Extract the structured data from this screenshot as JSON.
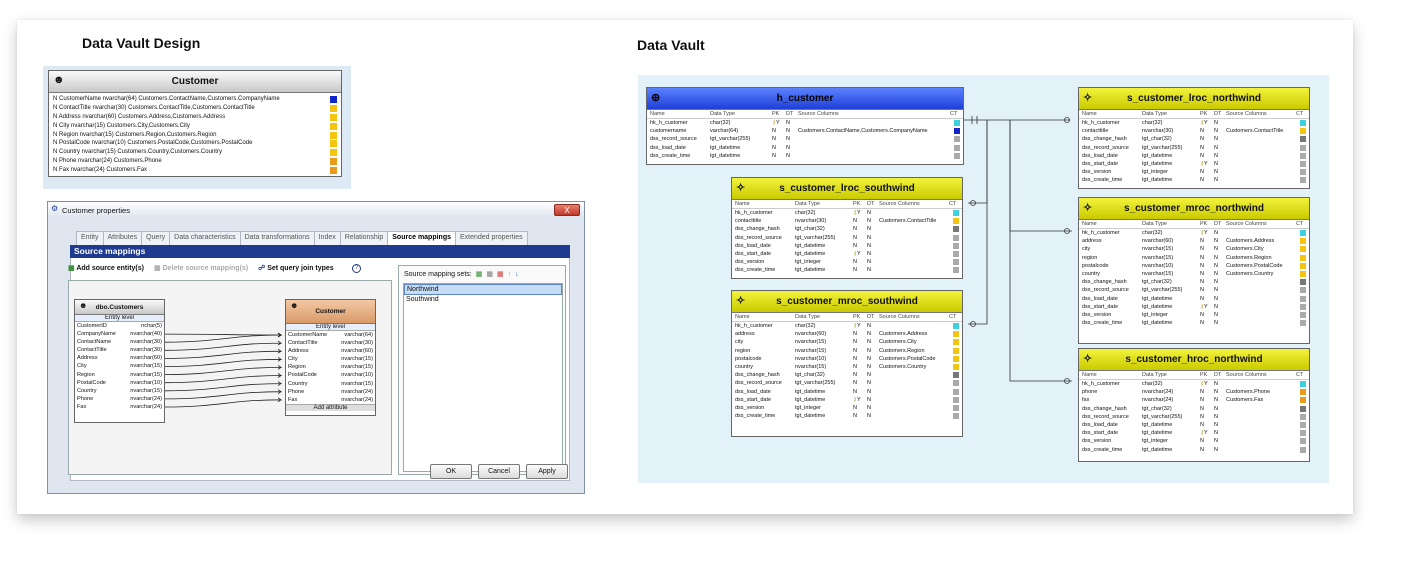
{
  "headings": {
    "left": "Data Vault Design",
    "right": "Data Vault"
  },
  "design_table": {
    "title": "Customer",
    "rows": [
      {
        "text": "N  CustomerName   nvarchar(64)   Customers.ContactName,Customers.CompanyName",
        "color": "#1226c9"
      },
      {
        "text": "N  ContactTitle      nvarchar(30)   Customers.ContactTitle,Customers.ContactTitle",
        "color": "#f4c410"
      },
      {
        "text": "N  Address           nvarchar(60)   Customers.Address,Customers.Address",
        "color": "#f4c410"
      },
      {
        "text": "N  City                 nvarchar(15)   Customers.City,Customers.City",
        "color": "#f4c410"
      },
      {
        "text": "N  Region            nvarchar(15)   Customers.Region,Customers.Region",
        "color": "#f4c410"
      },
      {
        "text": "N  PostalCode       nvarchar(10)   Customers.PostalCode,Customers.PostalCode",
        "color": "#f4c410"
      },
      {
        "text": "N  Country            nvarchar(15)   Customers.Country,Customers.Country",
        "color": "#f4c410"
      },
      {
        "text": "N  Phone              nvarchar(24)   Customers.Phone",
        "color": "#e89a1a"
      },
      {
        "text": "N  Fax                  nvarchar(24)   Customers.Fax",
        "color": "#e89a1a"
      }
    ]
  },
  "dialog": {
    "title": "Customer properties",
    "close": "X",
    "tabs": [
      "Entity",
      "Attributes",
      "Query",
      "Data characteristics",
      "Data transformations",
      "Index",
      "Relationship",
      "Source mappings",
      "Extended properties"
    ],
    "active_tab": "Source mappings",
    "section": "Source mappings",
    "toolbar": {
      "add": "Add source entity(s)",
      "delete": "Delete source mapping(s)",
      "join": "Set query join types"
    },
    "src_entity": {
      "title": "dbo.Customers",
      "level": "Entity level",
      "rows": [
        [
          "CustomerID",
          "nchar(5)"
        ],
        [
          "CompanyName",
          "nvarchar(40)"
        ],
        [
          "ContactName",
          "nvarchar(30)"
        ],
        [
          "ContactTitle",
          "nvarchar(30)"
        ],
        [
          "Address",
          "nvarchar(60)"
        ],
        [
          "City",
          "nvarchar(15)"
        ],
        [
          "Region",
          "nvarchar(15)"
        ],
        [
          "PostalCode",
          "nvarchar(10)"
        ],
        [
          "Country",
          "nvarchar(15)"
        ],
        [
          "Phone",
          "nvarchar(24)"
        ],
        [
          "Fax",
          "nvarchar(24)"
        ]
      ]
    },
    "tgt_entity": {
      "title": "Customer",
      "level": "Entity level",
      "add": "Add attribute",
      "rows": [
        [
          "CustomerName",
          "varchar(64)"
        ],
        [
          "ContactTitle",
          "nvarchar(30)"
        ],
        [
          "Address",
          "nvarchar(60)"
        ],
        [
          "City",
          "nvarchar(15)"
        ],
        [
          "Region",
          "nvarchar(15)"
        ],
        [
          "PostalCode",
          "nvarchar(10)"
        ],
        [
          "Country",
          "nvarchar(15)"
        ],
        [
          "Phone",
          "nvarchar(24)"
        ],
        [
          "Fax",
          "nvarchar(24)"
        ]
      ]
    },
    "sets_label": "Source mapping sets:",
    "sets": [
      "Northwind",
      "Southwind"
    ],
    "buttons": {
      "ok": "OK",
      "cancel": "Cancel",
      "apply": "Apply"
    }
  },
  "vault": {
    "cols": [
      "Name",
      "Data Type",
      "PK",
      "DT",
      "Source Columns",
      "CT"
    ],
    "tables": [
      {
        "id": "h",
        "title": "h_customer",
        "style": "blue",
        "rows": [
          [
            "hk_h_customer",
            "char(32)",
            "Y",
            "N",
            "",
            "#3dd1e0"
          ],
          [
            "customername",
            "varchar(64)",
            "N",
            "N",
            "Customers.ContactName,Customers.CompanyName",
            "#1226c9"
          ],
          [
            "dss_record_source",
            "tgt_varchar(255)",
            "N",
            "N",
            "",
            "#aaaaaa"
          ],
          [
            "dss_load_date",
            "tgt_datetime",
            "N",
            "N",
            "",
            "#aaaaaa"
          ],
          [
            "dss_create_time",
            "tgt_datetime",
            "N",
            "N",
            "",
            "#aaaaaa"
          ]
        ]
      },
      {
        "id": "lrs",
        "title": "s_customer_lroc_southwind",
        "style": "yellow",
        "rows": [
          [
            "hk_h_customer",
            "char(32)",
            "Y",
            "N",
            "",
            "#3dd1e0"
          ],
          [
            "contacttitle",
            "nvarchar(30)",
            "N",
            "N",
            "Customers.ContactTitle",
            "#f4c410"
          ],
          [
            "dss_change_hash",
            "tgt_char(32)",
            "N",
            "N",
            "",
            "#777777"
          ],
          [
            "dss_record_source",
            "tgt_varchar(255)",
            "N",
            "N",
            "",
            "#aaaaaa"
          ],
          [
            "dss_load_date",
            "tgt_datetime",
            "N",
            "N",
            "",
            "#aaaaaa"
          ],
          [
            "dss_start_date",
            "tgt_datetime",
            "Y",
            "N",
            "",
            "#aaaaaa"
          ],
          [
            "dss_version",
            "tgt_integer",
            "N",
            "N",
            "",
            "#aaaaaa"
          ],
          [
            "dss_create_time",
            "tgt_datetime",
            "N",
            "N",
            "",
            "#aaaaaa"
          ]
        ]
      },
      {
        "id": "mrs",
        "title": "s_customer_mroc_southwind",
        "style": "yellow",
        "rows": [
          [
            "hk_h_customer",
            "char(32)",
            "Y",
            "N",
            "",
            "#3dd1e0"
          ],
          [
            "address",
            "nvarchar(60)",
            "N",
            "N",
            "Customers.Address",
            "#f4c410"
          ],
          [
            "city",
            "nvarchar(15)",
            "N",
            "N",
            "Customers.City",
            "#f4c410"
          ],
          [
            "region",
            "nvarchar(15)",
            "N",
            "N",
            "Customers.Region",
            "#f4c410"
          ],
          [
            "postalcode",
            "nvarchar(10)",
            "N",
            "N",
            "Customers.PostalCode",
            "#f4c410"
          ],
          [
            "country",
            "nvarchar(15)",
            "N",
            "N",
            "Customers.Country",
            "#f4c410"
          ],
          [
            "dss_change_hash",
            "tgt_char(32)",
            "N",
            "N",
            "",
            "#777777"
          ],
          [
            "dss_record_source",
            "tgt_varchar(255)",
            "N",
            "N",
            "",
            "#aaaaaa"
          ],
          [
            "dss_load_date",
            "tgt_datetime",
            "N",
            "N",
            "",
            "#aaaaaa"
          ],
          [
            "dss_start_date",
            "tgt_datetime",
            "Y",
            "N",
            "",
            "#aaaaaa"
          ],
          [
            "dss_version",
            "tgt_integer",
            "N",
            "N",
            "",
            "#aaaaaa"
          ],
          [
            "dss_create_time",
            "tgt_datetime",
            "N",
            "N",
            "",
            "#aaaaaa"
          ]
        ]
      },
      {
        "id": "lrn",
        "title": "s_customer_lroc_northwind",
        "style": "yellow",
        "rows": [
          [
            "hk_h_customer",
            "char(32)",
            "Y",
            "N",
            "",
            "#3dd1e0"
          ],
          [
            "contacttitle",
            "nvarchar(30)",
            "N",
            "N",
            "Customers.ContactTitle",
            "#f4c410"
          ],
          [
            "dss_change_hash",
            "tgt_char(32)",
            "N",
            "N",
            "",
            "#777777"
          ],
          [
            "dss_record_source",
            "tgt_varchar(255)",
            "N",
            "N",
            "",
            "#aaaaaa"
          ],
          [
            "dss_load_date",
            "tgt_datetime",
            "N",
            "N",
            "",
            "#aaaaaa"
          ],
          [
            "dss_start_date",
            "tgt_datetime",
            "Y",
            "N",
            "",
            "#aaaaaa"
          ],
          [
            "dss_version",
            "tgt_integer",
            "N",
            "N",
            "",
            "#aaaaaa"
          ],
          [
            "dss_create_time",
            "tgt_datetime",
            "N",
            "N",
            "",
            "#aaaaaa"
          ]
        ]
      },
      {
        "id": "mrn",
        "title": "s_customer_mroc_northwind",
        "style": "yellow",
        "rows": [
          [
            "hk_h_customer",
            "char(32)",
            "Y",
            "N",
            "",
            "#3dd1e0"
          ],
          [
            "address",
            "nvarchar(60)",
            "N",
            "N",
            "Customers.Address",
            "#f4c410"
          ],
          [
            "city",
            "nvarchar(15)",
            "N",
            "N",
            "Customers.City",
            "#f4c410"
          ],
          [
            "region",
            "nvarchar(15)",
            "N",
            "N",
            "Customers.Region",
            "#f4c410"
          ],
          [
            "postalcode",
            "nvarchar(10)",
            "N",
            "N",
            "Customers.PostalCode",
            "#f4c410"
          ],
          [
            "country",
            "nvarchar(15)",
            "N",
            "N",
            "Customers.Country",
            "#f4c410"
          ],
          [
            "dss_change_hash",
            "tgt_char(32)",
            "N",
            "N",
            "",
            "#777777"
          ],
          [
            "dss_record_source",
            "tgt_varchar(255)",
            "N",
            "N",
            "",
            "#aaaaaa"
          ],
          [
            "dss_load_date",
            "tgt_datetime",
            "N",
            "N",
            "",
            "#aaaaaa"
          ],
          [
            "dss_start_date",
            "tgt_datetime",
            "Y",
            "N",
            "",
            "#aaaaaa"
          ],
          [
            "dss_version",
            "tgt_integer",
            "N",
            "N",
            "",
            "#aaaaaa"
          ],
          [
            "dss_create_time",
            "tgt_datetime",
            "N",
            "N",
            "",
            "#aaaaaa"
          ]
        ]
      },
      {
        "id": "hrn",
        "title": "s_customer_hroc_northwind",
        "style": "yellow",
        "rows": [
          [
            "hk_h_customer",
            "char(32)",
            "Y",
            "N",
            "",
            "#3dd1e0"
          ],
          [
            "phone",
            "nvarchar(24)",
            "N",
            "N",
            "Customers.Phone",
            "#e89a1a"
          ],
          [
            "fax",
            "nvarchar(24)",
            "N",
            "N",
            "Customers.Fax",
            "#e89a1a"
          ],
          [
            "dss_change_hash",
            "tgt_char(32)",
            "N",
            "N",
            "",
            "#777777"
          ],
          [
            "dss_record_source",
            "tgt_varchar(255)",
            "N",
            "N",
            "",
            "#aaaaaa"
          ],
          [
            "dss_load_date",
            "tgt_datetime",
            "N",
            "N",
            "",
            "#aaaaaa"
          ],
          [
            "dss_start_date",
            "tgt_datetime",
            "Y",
            "N",
            "",
            "#aaaaaa"
          ],
          [
            "dss_version",
            "tgt_integer",
            "N",
            "N",
            "",
            "#aaaaaa"
          ],
          [
            "dss_create_time",
            "tgt_datetime",
            "N",
            "N",
            "",
            "#aaaaaa"
          ]
        ]
      }
    ]
  }
}
